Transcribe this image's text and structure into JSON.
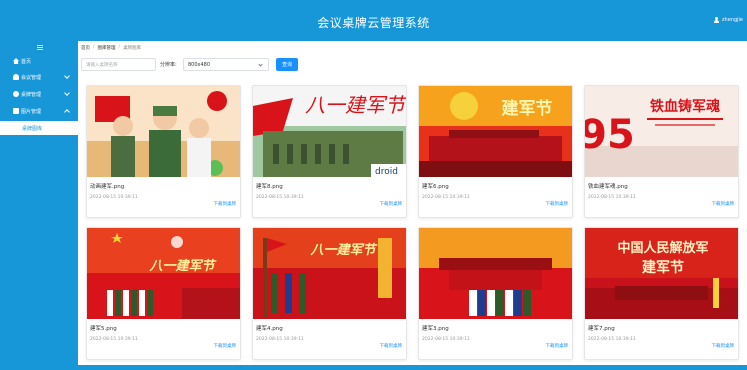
{
  "header": {
    "title": "会议桌牌云管理系统",
    "username": "zhengjie"
  },
  "sidebar": {
    "items": [
      {
        "label": "首页",
        "icon": "home-icon"
      },
      {
        "label": "会议管理",
        "icon": "person-icon"
      },
      {
        "label": "桌牌管理",
        "icon": "gear-icon"
      },
      {
        "label": "图片管理",
        "icon": "image-icon"
      }
    ],
    "active_sub": "桌牌图库"
  },
  "breadcrumb": [
    "首页",
    "图库管理",
    "桌牌图库"
  ],
  "filters": {
    "search_placeholder": "请输入桌牌名称",
    "resolution_label": "分辨率:",
    "resolution_value": "800x480",
    "query_button": "查询"
  },
  "cards": [
    {
      "name": "动画建军.png",
      "time": "2022-08-15 10:39:11",
      "download": "下载到桌牌"
    },
    {
      "name": "建军8.png",
      "time": "2022-08-15 10:39:11",
      "download": "下载到桌牌"
    },
    {
      "name": "建军6.png",
      "time": "2022-08-15 10:39:11",
      "download": "下载到桌牌"
    },
    {
      "name": "铁血建军魂.png",
      "time": "2022-08-15 10:39:11",
      "download": "下载到桌牌"
    },
    {
      "name": "建军5.png",
      "time": "2022-08-15 10:39:11",
      "download": "下载到桌牌"
    },
    {
      "name": "建军4.png",
      "time": "2022-08-15 10:39:11",
      "download": "下载到桌牌"
    },
    {
      "name": "建军3.png",
      "time": "2022-08-15 10:39:11",
      "download": "下载到桌牌"
    },
    {
      "name": "建军7.png",
      "time": "2022-08-15 10:39:11",
      "download": "下载到桌牌"
    }
  ],
  "poster_text": {
    "card2": "八一建军节",
    "card2_corner": "droid",
    "card3": "建军节",
    "card4_title": "铁血铸军魂",
    "card4_number": "95",
    "card5": "八一建军节",
    "card6": "八一建军节",
    "card8_line1": "中国人民解放军",
    "card8_line2": "建军节"
  },
  "colors": {
    "primary": "#1796d8",
    "link": "#1890ff",
    "poster_red": "#d8141a"
  }
}
